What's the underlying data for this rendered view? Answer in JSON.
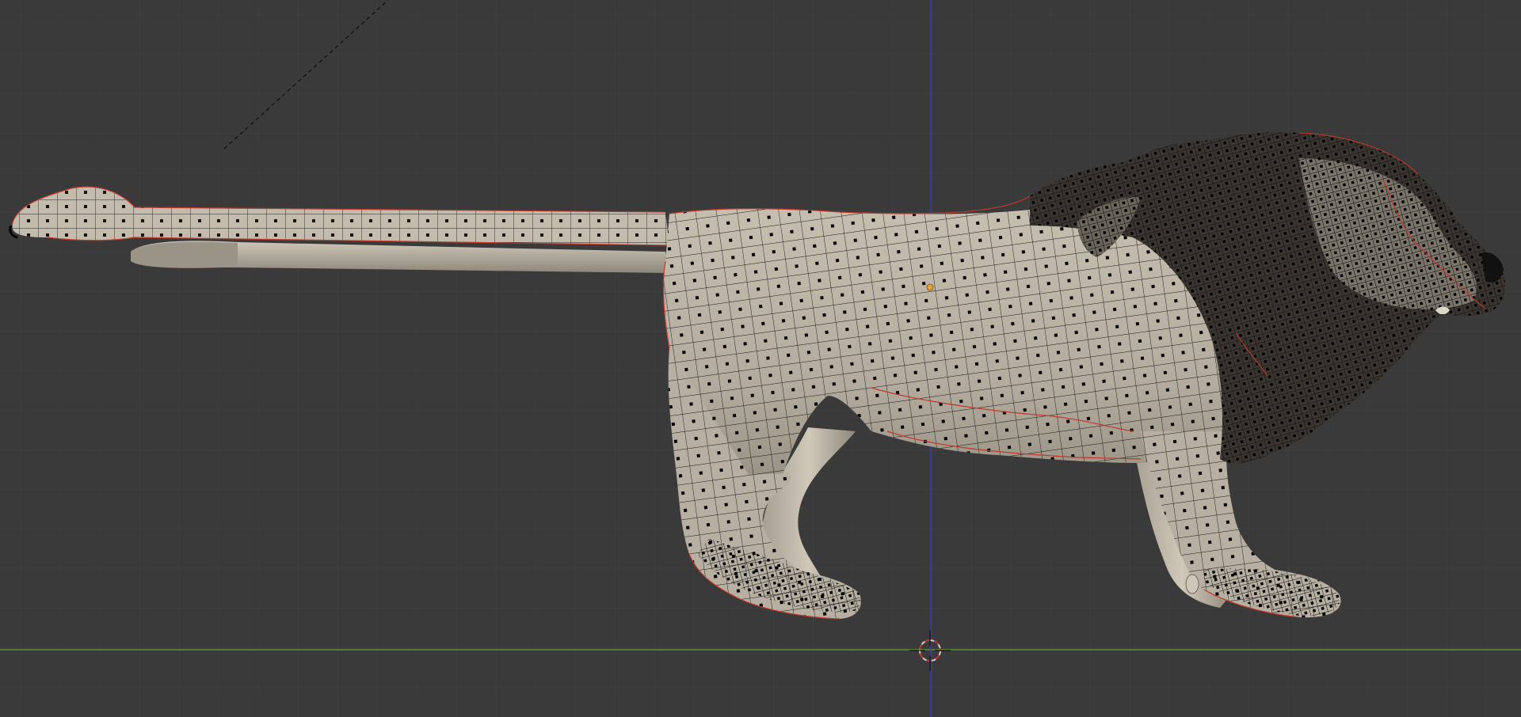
{
  "viewport": {
    "view": "3d-viewport",
    "mode": "edit-mode",
    "shading": "solid-with-wireframe-overlay"
  },
  "scene": {
    "object_name": "",
    "object_type": "lion-mesh"
  },
  "colors": {
    "background": "#3a3a3a",
    "grid_minor": "#434343",
    "grid_major": "#4a4a4a",
    "x_axis": "#5a8f3a",
    "z_axis": "#3b3bb0",
    "mesh_fill": "#b9b2a4",
    "mesh_shadow": "#8a8478",
    "wire": "#111111",
    "seam": "#c0392b",
    "vertex": "#000000",
    "origin_dot": "#e8a33c",
    "cursor_ring": "#cfcfcf",
    "cursor_accent": "#c0392b"
  },
  "icons": {
    "cursor": "3d-cursor-icon",
    "origin": "object-origin-icon"
  }
}
